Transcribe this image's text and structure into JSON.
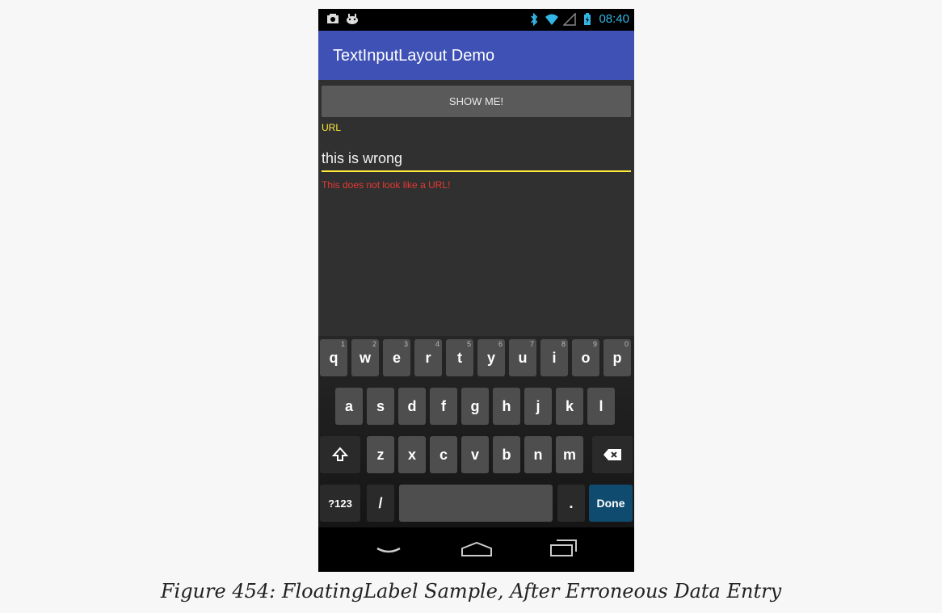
{
  "status_bar": {
    "time": "08:40",
    "left_icons": [
      "photo-icon",
      "android-icon"
    ],
    "right_icons": [
      "bluetooth-icon",
      "wifi-icon",
      "signal-icon",
      "battery-icon"
    ],
    "accent_color": "#33b5e5"
  },
  "app_bar": {
    "title": "TextInputLayout Demo",
    "color": "#3f51b5"
  },
  "form": {
    "button_label": "SHOW ME!",
    "field_label": "URL",
    "field_value": "this is wrong",
    "error_message": "This does not look like a URL!",
    "label_color": "#ffeb3b",
    "error_color": "#e53935"
  },
  "keyboard": {
    "row1": [
      {
        "key": "q",
        "hint": "1"
      },
      {
        "key": "w",
        "hint": "2"
      },
      {
        "key": "e",
        "hint": "3"
      },
      {
        "key": "r",
        "hint": "4"
      },
      {
        "key": "t",
        "hint": "5"
      },
      {
        "key": "y",
        "hint": "6"
      },
      {
        "key": "u",
        "hint": "7"
      },
      {
        "key": "i",
        "hint": "8"
      },
      {
        "key": "o",
        "hint": "9"
      },
      {
        "key": "p",
        "hint": "0"
      }
    ],
    "row2": [
      "a",
      "s",
      "d",
      "f",
      "g",
      "h",
      "j",
      "k",
      "l"
    ],
    "row3": [
      "z",
      "x",
      "c",
      "v",
      "b",
      "n",
      "m"
    ],
    "symbols_label": "?123",
    "slash_label": "/",
    "period_label": ".",
    "done_label": "Done",
    "shift_icon": "shift-icon",
    "backspace_icon": "backspace-icon"
  },
  "nav_bar": {
    "icons": [
      "back-icon",
      "home-icon",
      "recents-icon"
    ]
  },
  "caption": "Figure 454: FloatingLabel Sample, After Erroneous Data Entry"
}
